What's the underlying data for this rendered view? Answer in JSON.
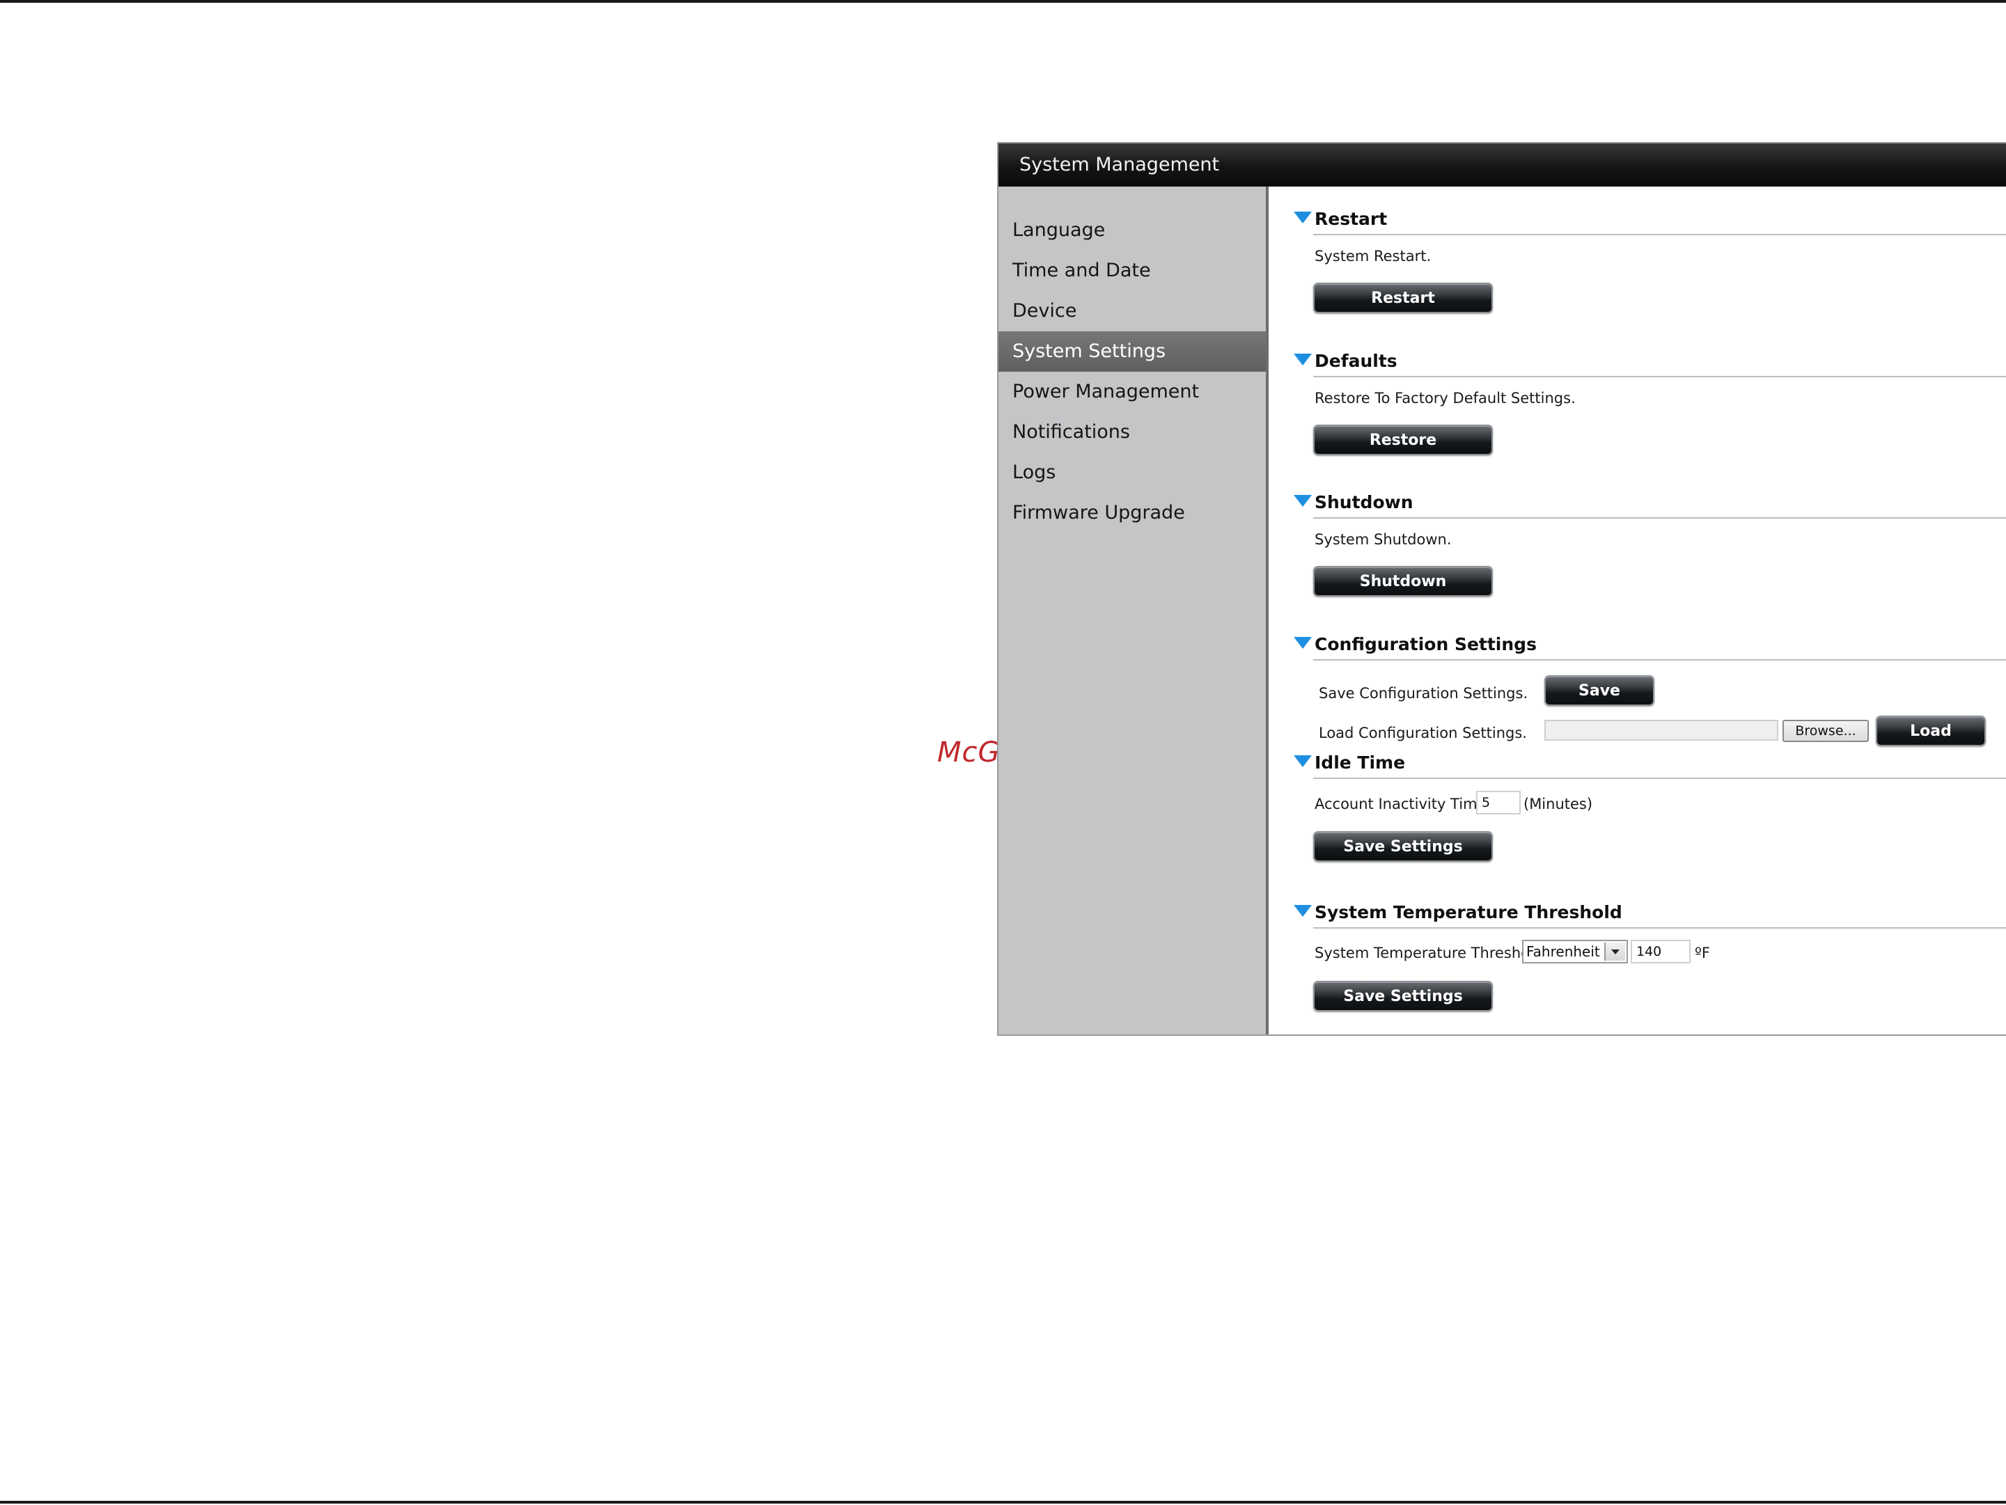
{
  "watermark": "McGrp.Ru",
  "panel": {
    "title": "System Management"
  },
  "sidebar": {
    "items": [
      {
        "label": "Language"
      },
      {
        "label": "Time and Date"
      },
      {
        "label": "Device"
      },
      {
        "label": "System Settings",
        "active": true
      },
      {
        "label": "Power Management"
      },
      {
        "label": "Notifications"
      },
      {
        "label": "Logs"
      },
      {
        "label": "Firmware Upgrade"
      }
    ]
  },
  "sections": {
    "restart": {
      "title": "Restart",
      "description": "System Restart.",
      "button": "Restart"
    },
    "defaults": {
      "title": "Defaults",
      "description": "Restore To Factory Default Settings.",
      "button": "Restore"
    },
    "shutdown": {
      "title": "Shutdown",
      "description": "System Shutdown.",
      "button": "Shutdown"
    },
    "config": {
      "title": "Configuration Settings",
      "save_label": "Save Configuration Settings.",
      "save_button": "Save",
      "load_label": "Load Configuration Settings.",
      "file_value": "",
      "browse_button": "Browse...",
      "load_button": "Load"
    },
    "idle": {
      "title": "Idle Time",
      "timer_label": "Account Inactivity Timer",
      "timer_value": "5",
      "timer_unit": "(Minutes)",
      "button": "Save Settings"
    },
    "temperature": {
      "title": "System Temperature Threshold",
      "label": "System Temperature Threshold",
      "unit_selected": "Fahrenheit",
      "value": "140",
      "unit_symbol": "ºF",
      "button": "Save Settings"
    }
  },
  "colors": {
    "accent_triangle": "#1e8fe0",
    "watermark": "#c0282d",
    "sidebar_bg": "#c4c5c7",
    "sidebar_active": "#666666"
  }
}
